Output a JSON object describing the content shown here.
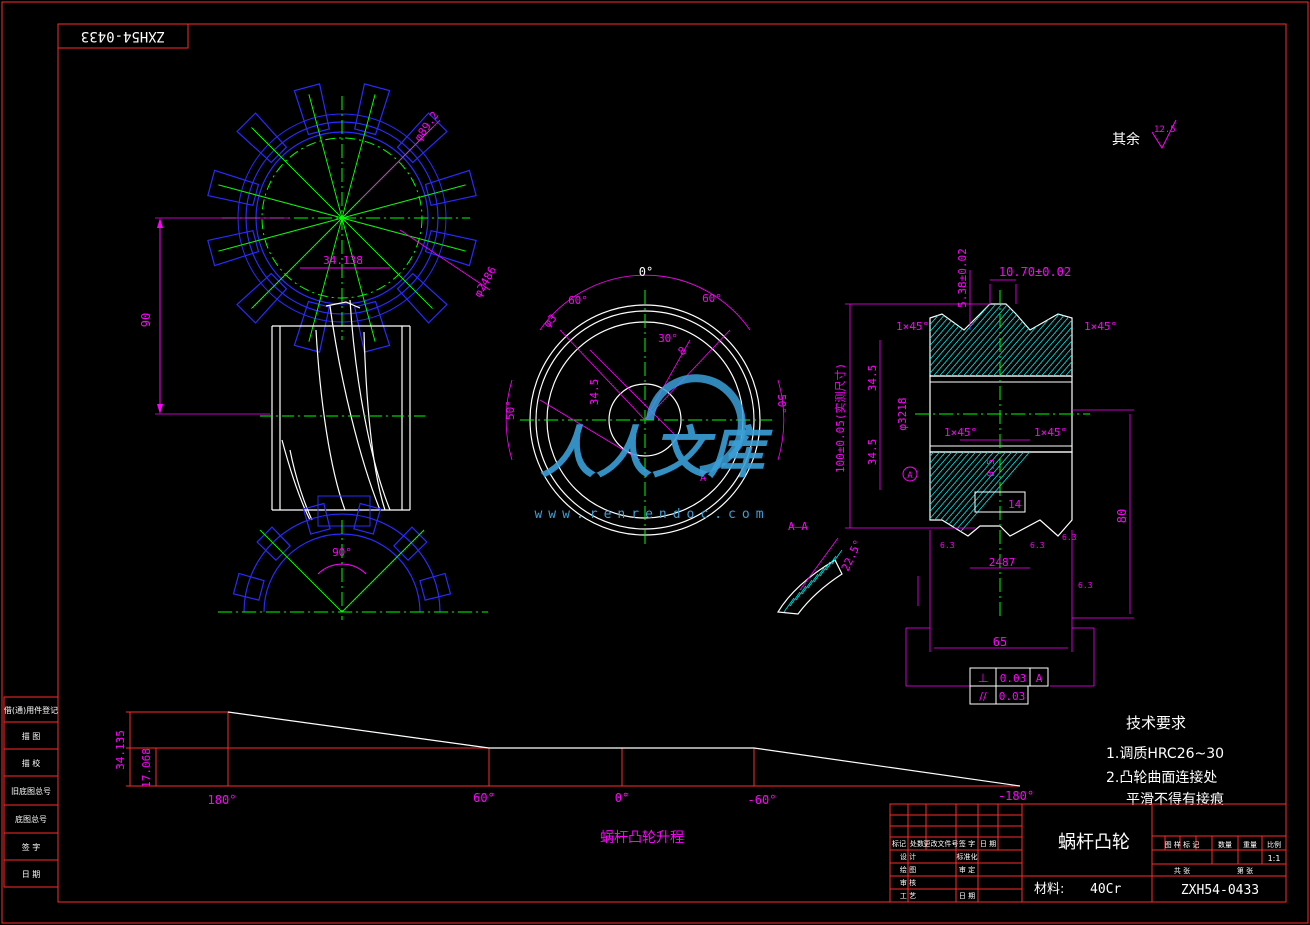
{
  "drawing_no_top": "ZXH54-0433",
  "surface_other": "其余",
  "surface_value": "12.5",
  "gear": {
    "dia_outer": "φ89.2",
    "dia_root": "φ2486",
    "width": "34.138",
    "height": "90",
    "angle": "90°"
  },
  "cam_face": {
    "a0": "0°",
    "a60l": "60°",
    "a60r": "60°",
    "a30": "30°",
    "a50l": "50°",
    "a50r": "50°",
    "d1": "34.5",
    "d2": "8",
    "d3": "φ3",
    "label_a": "A",
    "section": "A—A",
    "section_angle": "22.5°"
  },
  "section_view": {
    "top_dim": "10.70±0.02",
    "vert_dim": "5.38±0.02",
    "chamfer": "1×45°",
    "chamfer2": "1×45°",
    "chamfer3": "1×45°",
    "chamfer4": "1×45°",
    "d_upper": "34.5",
    "d_lower": "34.5",
    "total": "100±0.05(实测尺寸)",
    "bore": "φ3218",
    "dim_05": "0.5",
    "dim_14": "14",
    "dim_2487": "2487",
    "height_80": "80",
    "width_65": "65",
    "gt1_sym": "⊥",
    "gt1_val": "0.03",
    "gt1_ref": "A",
    "gt2_sym": "//",
    "gt2_val": "0.03",
    "datum": "A",
    "r1": "6.3",
    "r2": "6.3",
    "r3": "6.3",
    "r4": "6.3"
  },
  "tech": {
    "title": "技术要求",
    "line1": "1.调质HRC26~30",
    "line2": "2.凸轮曲面连接处",
    "line3": "平滑不得有接痕"
  },
  "lift": {
    "y1": "34.135",
    "y2": "17.068",
    "x1": "180°",
    "x2": "60°",
    "x3": "0°",
    "x4": "-60°",
    "x5": "-180°",
    "caption": "蜗杆凸轮升程"
  },
  "side_table": [
    "借(通)用件登记",
    "描  图",
    "描  校",
    "旧底图总号",
    "底图总号",
    "签  字",
    "日  期"
  ],
  "title_block": {
    "part_name": "蜗杆凸轮",
    "material_label": "材料:",
    "material": "40Cr",
    "drawing_no": "ZXH54-0433",
    "scale": "1:1",
    "h_mark": "标记",
    "h_count": "处数",
    "h_file": "更改文件号",
    "h_sign": "签 字",
    "h_date": "日 期",
    "r_design": "设 计",
    "r_std": "标准化",
    "r_draw": "绘 图",
    "r_review": "审 定",
    "r_check": "审 核",
    "r_process": "工 艺",
    "r_date": "日 期",
    "c_stage": "图 样 标 记",
    "c_qty": "数量",
    "c_weight": "重量",
    "c_ratio": "比例",
    "c_total": "共  张",
    "c_sheet": "第  张"
  },
  "watermark": {
    "brand": "人人文库",
    "url": "www.renrendoc.com"
  },
  "colors": {
    "border": "#ff2a2a",
    "gear_blue": "#2a2aff",
    "center_green": "#00ff00",
    "dim_magenta": "#ff00ff",
    "part_white": "#ffffff",
    "cyan_hatch": "#00e5e5",
    "title_text": "#ffffff"
  }
}
